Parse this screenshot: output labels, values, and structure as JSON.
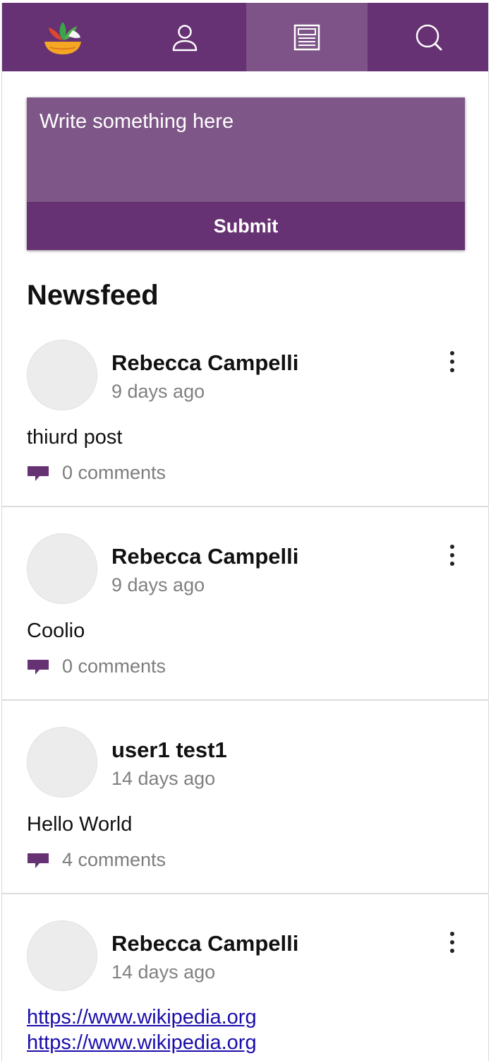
{
  "nav": {
    "items": [
      {
        "name": "logo",
        "icon": "app-logo-bowl-icon"
      },
      {
        "name": "profile",
        "icon": "user-icon"
      },
      {
        "name": "newsfeed",
        "icon": "newsfeed-icon",
        "active": true
      },
      {
        "name": "search",
        "icon": "search-icon"
      }
    ],
    "colors": {
      "bar": "#663273",
      "active": "#7e5488"
    }
  },
  "composer": {
    "placeholder": "Write something here",
    "submit_label": "Submit"
  },
  "feed": {
    "title": "Newsfeed",
    "posts": [
      {
        "author": "Rebecca Campelli",
        "time": "9 days ago",
        "content": "thiurd post",
        "comments": "0 comments",
        "has_menu": true
      },
      {
        "author": "Rebecca Campelli",
        "time": "9 days ago",
        "content": "Coolio",
        "comments": "0 comments",
        "has_menu": true
      },
      {
        "author": "user1 test1",
        "time": "14 days ago",
        "content": "Hello World",
        "comments": "4 comments",
        "has_menu": false
      },
      {
        "author": "Rebecca Campelli",
        "time": "14 days ago",
        "links": [
          "https://www.wikipedia.org",
          "https://www.wikipedia.org"
        ],
        "has_menu": true
      }
    ]
  },
  "colors": {
    "accent": "#663273",
    "muted_text": "#808080",
    "link": "#1a0dab"
  }
}
